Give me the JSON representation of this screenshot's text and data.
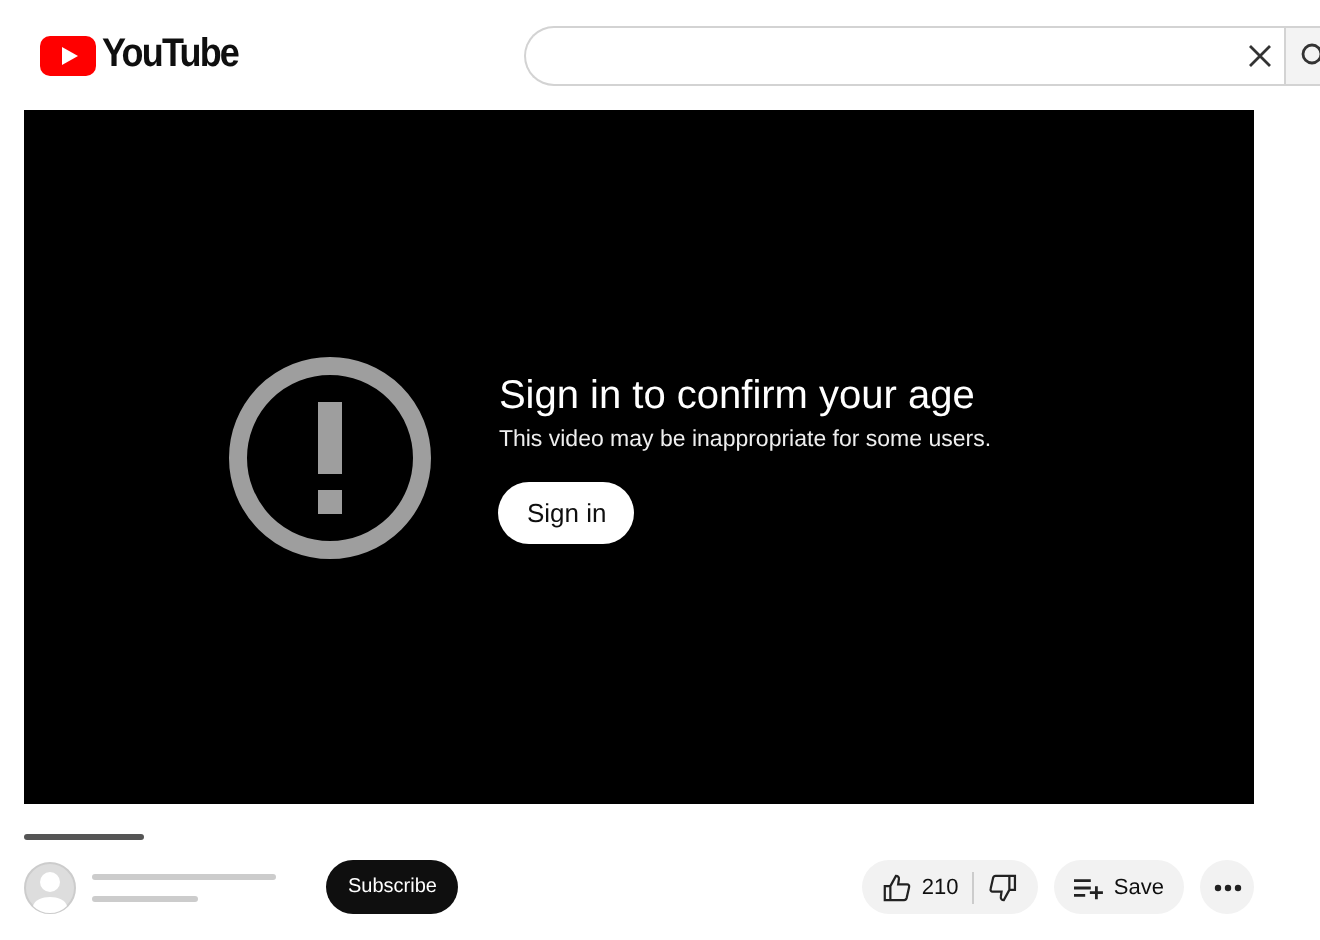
{
  "header": {
    "logo": "YouTube"
  },
  "player": {
    "title": "Sign in to confirm your age",
    "message": "This video may be inappropriate for some users.",
    "button": "Sign in"
  },
  "channel": {
    "subscribe": "Subscribe"
  },
  "actions": {
    "likes": "210",
    "save": "Save"
  }
}
